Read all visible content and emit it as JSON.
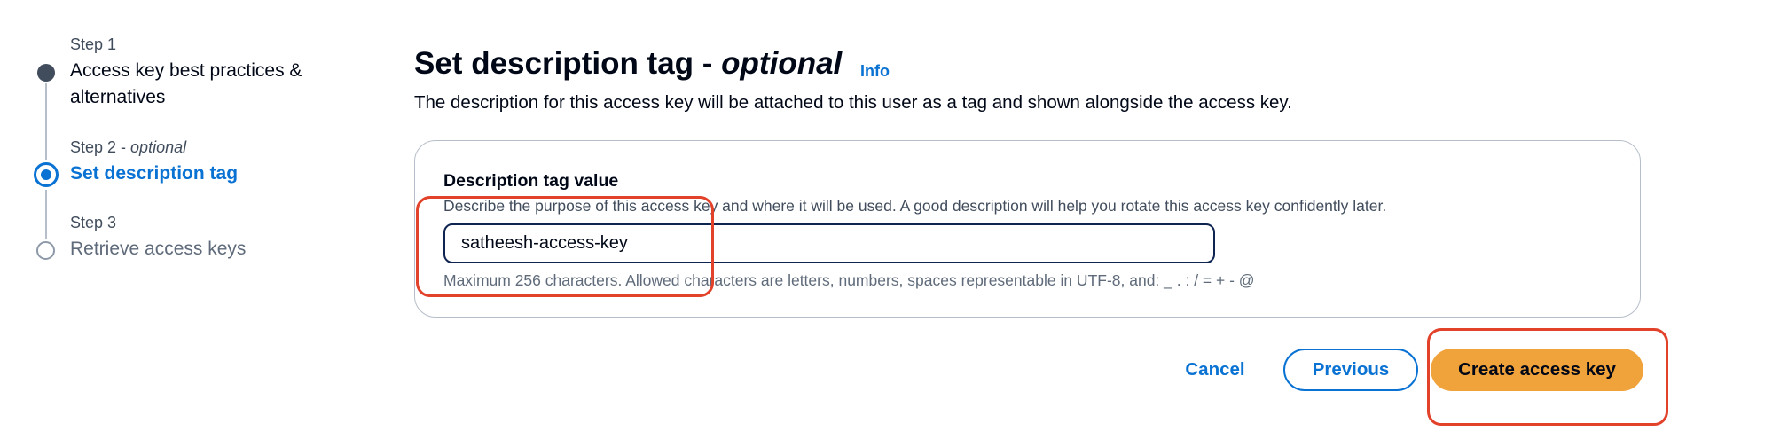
{
  "stepper": {
    "steps": [
      {
        "label": "Step 1",
        "optional": "",
        "title": "Access key best practices & alternatives",
        "state": "completed"
      },
      {
        "label": "Step 2",
        "optional": "optional",
        "title": "Set description tag",
        "state": "current"
      },
      {
        "label": "Step 3",
        "optional": "",
        "title": "Retrieve access keys",
        "state": "upcoming"
      }
    ]
  },
  "header": {
    "title": "Set description tag",
    "title_separator": " - ",
    "title_optional": "optional",
    "info_link": "Info",
    "description": "The description for this access key will be attached to this user as a tag and shown alongside the access key."
  },
  "form": {
    "label": "Description tag value",
    "description": "Describe the purpose of this access key and where it will be used. A good description will help you rotate this access key confidently later.",
    "value": "satheesh-access-key",
    "constraint": "Maximum 256 characters. Allowed characters are letters, numbers, spaces representable in UTF-8, and: _ . : / = + - @"
  },
  "actions": {
    "cancel": "Cancel",
    "previous": "Previous",
    "create": "Create access key"
  },
  "colors": {
    "accent": "#0972d3",
    "primary_button": "#f0a23b",
    "annotation": "#e2412a",
    "text": "#000716"
  }
}
